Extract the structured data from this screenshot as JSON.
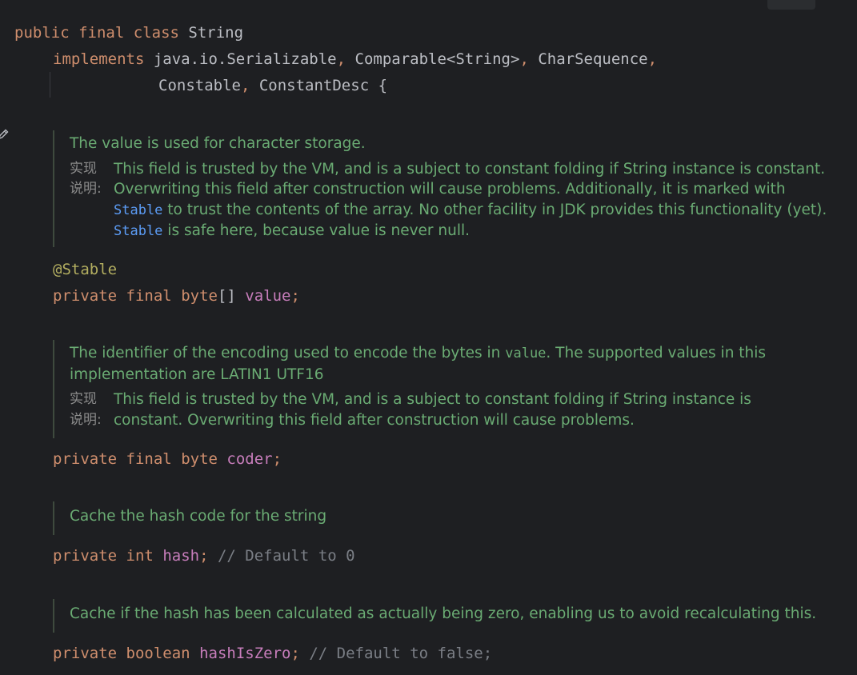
{
  "code": {
    "class_decl": {
      "kw_public": "public",
      "kw_final": "final",
      "kw_class": "class",
      "name": "String"
    },
    "implements_line": {
      "kw_implements": "implements",
      "t1": "java.io.Serializable",
      "c1": ",",
      "t2": "Comparable<String>",
      "c2": ",",
      "t3": "CharSequence",
      "c3": ","
    },
    "implements_line2": {
      "t4": "Constable",
      "c4": ",",
      "t5": "ConstantDesc",
      "brace": "{"
    },
    "value_field": {
      "annotation": "@Stable",
      "kw_private": "private",
      "kw_final": "final",
      "type": "byte",
      "brackets": "[]",
      "name": "value",
      "semi": ";"
    },
    "coder_field": {
      "kw_private": "private",
      "kw_final": "final",
      "kw_byte": "byte",
      "name": "coder",
      "semi": ";"
    },
    "hash_field": {
      "kw_private": "private",
      "kw_int": "int",
      "name": "hash",
      "semi": ";",
      "comment": "// Default to 0"
    },
    "hashiszero_field": {
      "kw_private": "private",
      "kw_boolean": "boolean",
      "name": "hashIsZero",
      "semi": ";",
      "comment": "// Default to false;"
    }
  },
  "docs": {
    "value": {
      "summary": "The value is used for character storage.",
      "tag_label": "实现\n说明:",
      "note_a": "This field is trusted by the VM, and is a subject to constant folding if String instance is constant. Overwriting this field after construction will cause problems. Additionally, it is marked with ",
      "link1": "Stable",
      "note_b": " to trust the contents of the array. No other facility in JDK provides this functionality (yet). ",
      "link2": "Stable",
      "note_c": " is safe here, because value is never null."
    },
    "coder": {
      "summary_a": "The identifier of the encoding used to encode the bytes in ",
      "summary_code": "value",
      "summary_b": ". The supported values in this implementation are LATIN1 UTF16",
      "tag_label": "实现\n说明:",
      "note": "This field is trusted by the VM, and is a subject to constant folding if String instance is constant. Overwriting this field after construction will cause problems."
    },
    "hash": {
      "summary": "Cache the hash code for the string"
    },
    "hashiszero": {
      "summary": "Cache if the hash has been calculated as actually being zero, enabling us to avoid recalculating this."
    }
  },
  "icons": {
    "gutter": "pencil-icon"
  }
}
